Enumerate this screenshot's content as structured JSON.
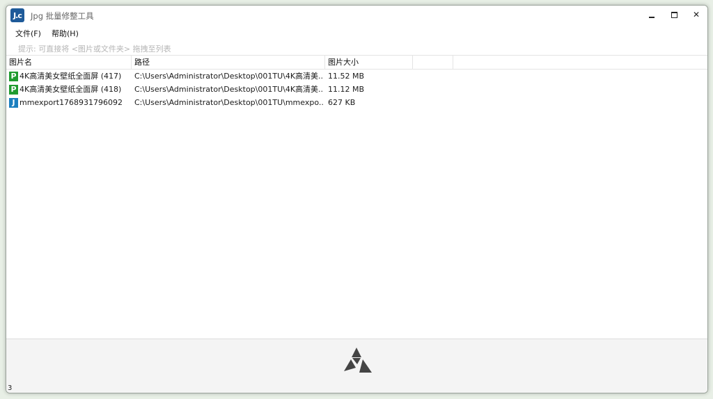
{
  "window": {
    "title": "Jpg 批量修整工具",
    "app_icon_text": "J.c"
  },
  "menu": {
    "file": "文件(F)",
    "help": "帮助(H)"
  },
  "hint": "提示: 可直接将 <图片或文件夹> 拖拽至列表",
  "columns": {
    "name": "图片名",
    "path": "路径",
    "size": "图片大小"
  },
  "rows": [
    {
      "type": "P",
      "type_icon": "png-file-icon",
      "name": "4K高清美女壁纸全面屏 (417)",
      "path": "C:\\Users\\Administrator\\Desktop\\001TU\\4K高清美...",
      "size": "11.52 MB"
    },
    {
      "type": "P",
      "type_icon": "png-file-icon",
      "name": "4K高清美女壁纸全面屏 (418)",
      "path": "C:\\Users\\Administrator\\Desktop\\001TU\\4K高清美...",
      "size": "11.12 MB"
    },
    {
      "type": "J",
      "type_icon": "jpg-file-icon",
      "name": "mmexport1768931796092",
      "path": "C:\\Users\\Administrator\\Desktop\\001TU\\mmexpo...",
      "size": "627 KB"
    }
  ],
  "status": {
    "count": "3"
  },
  "colors": {
    "png_badge": "#1f9b2f",
    "jpg_badge": "#1b7fbf",
    "app_icon": "#1e5a99",
    "process_icon": "#444444"
  },
  "icons": {
    "process": "triangle-logo-icon"
  }
}
